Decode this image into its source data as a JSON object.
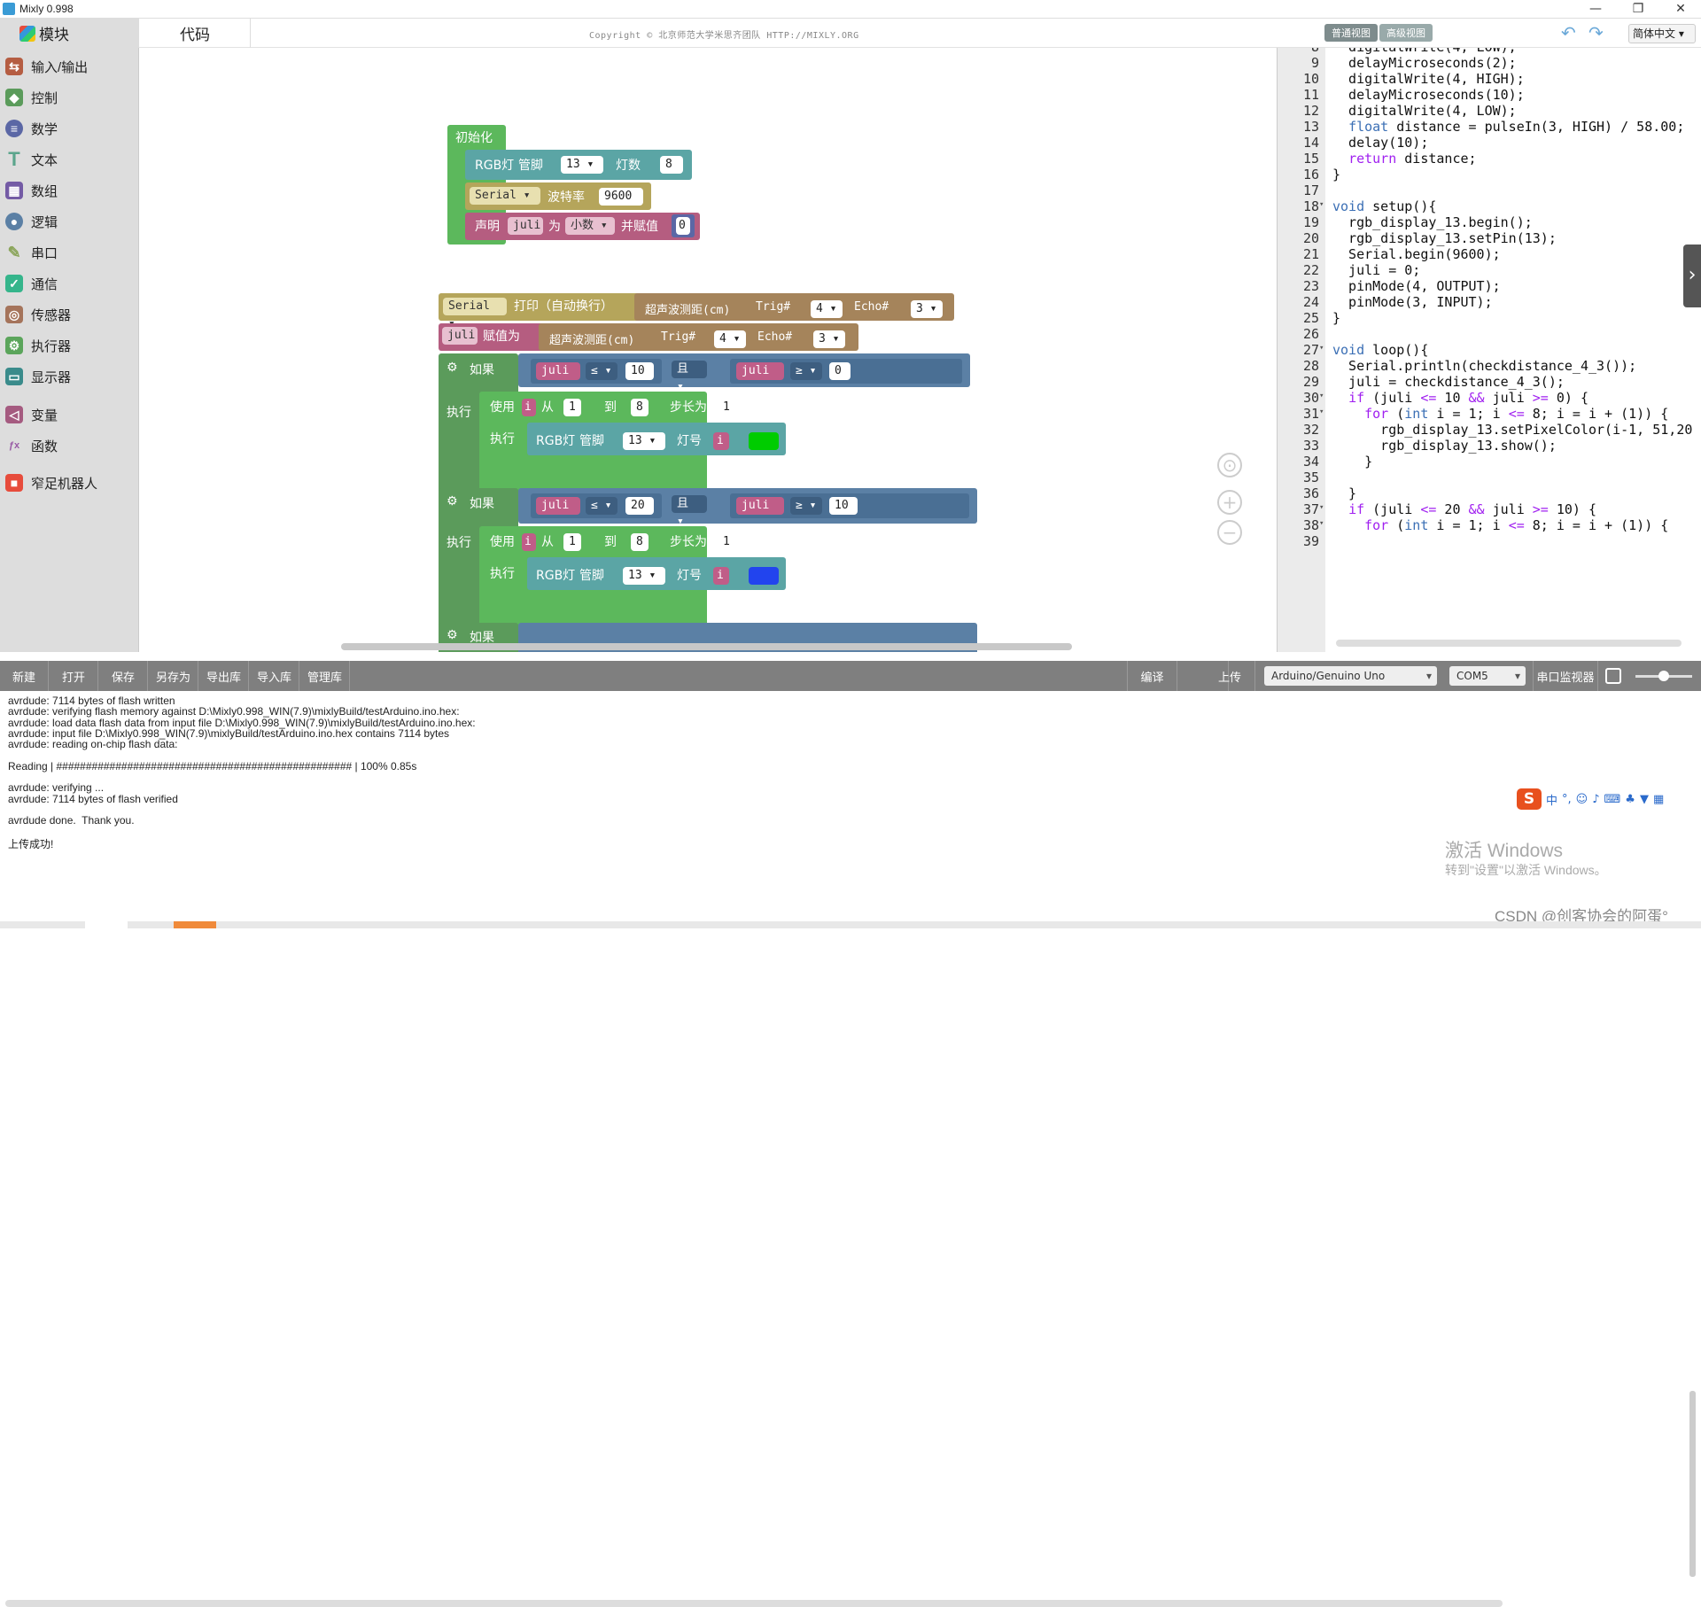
{
  "window": {
    "title": "Mixly 0.998",
    "min": "—",
    "max": "❐",
    "close": "✕"
  },
  "topbar": {
    "tab_blocks": "模块",
    "tab_code": "代码",
    "copyright": "Copyright © 北京师范大学米思齐团队 HTTP://MIXLY.ORG",
    "view_normal": "普通视图",
    "view_advanced": "高级视图",
    "language": "简体中文"
  },
  "sidebar": {
    "items": [
      {
        "label": "输入/输出",
        "icon": "io-icon",
        "color": "#b55d42"
      },
      {
        "label": "控制",
        "icon": "gamepad-icon",
        "color": "#5b9b5b"
      },
      {
        "label": "数学",
        "icon": "math-icon",
        "color": "#5b67a5"
      },
      {
        "label": "文本",
        "icon": "text-icon",
        "color": "#5ba58c"
      },
      {
        "label": "数组",
        "icon": "array-icon",
        "color": "#745ba5"
      },
      {
        "label": "逻辑",
        "icon": "bulb-icon",
        "color": "#5b80a5"
      },
      {
        "label": "串口",
        "icon": "pen-icon",
        "color": "#8ba55b"
      },
      {
        "label": "通信",
        "icon": "comm-icon",
        "color": "#35b58b"
      },
      {
        "label": "传感器",
        "icon": "sensor-icon",
        "color": "#a5745b"
      },
      {
        "label": "执行器",
        "icon": "actuator-icon",
        "color": "#5ba55b"
      },
      {
        "label": "显示器",
        "icon": "display-icon",
        "color": "#3a8b8b"
      },
      {
        "label": "变量",
        "icon": "variable-icon",
        "color": "#a55b80"
      },
      {
        "label": "函数",
        "icon": "function-icon",
        "color": "#995ba5"
      },
      {
        "label": "窄足机器人",
        "icon": "robot-icon",
        "color": "#e74c3c"
      }
    ]
  },
  "blocks": {
    "init": "初始化",
    "rgb": "RGB灯",
    "pin": "管脚",
    "pin13": "13",
    "count": "灯数",
    "count8": "8",
    "serial": "Serial",
    "baud": "波特率",
    "baud_val": "9600",
    "declare": "声明",
    "juli": "juli",
    "as": "为",
    "type": "小数",
    "assign": "并赋值",
    "zero": "0",
    "print": "打印（自动换行）",
    "ultra": "超声波测距(cm)",
    "trig": "Trig#",
    "trig_v": "4",
    "echo": "Echo#",
    "echo_v": "3",
    "assign_to": "赋值为",
    "if": "如果",
    "do": "执行",
    "and": "且",
    "le": "≤",
    "ge": "≥",
    "v10": "10",
    "v0": "0",
    "v20": "20",
    "for_use": "使用",
    "i": "i",
    "from": "从",
    "one": "1",
    "to": "到",
    "eight": "8",
    "step": "步长为",
    "step_v": "1",
    "lamp": "灯号",
    "color1": "#00cc00",
    "color2": "#2244ee"
  },
  "code": {
    "lines": [
      {
        "n": "8",
        "t": "  digitalWrite(4, LOW);"
      },
      {
        "n": "9",
        "t": "  delayMicroseconds(2);"
      },
      {
        "n": "10",
        "t": "  digitalWrite(4, HIGH);"
      },
      {
        "n": "11",
        "t": "  delayMicroseconds(10);"
      },
      {
        "n": "12",
        "t": "  digitalWrite(4, LOW);"
      },
      {
        "n": "13",
        "t": "  float distance = pulseIn(3, HIGH) / 58.00;"
      },
      {
        "n": "14",
        "t": "  delay(10);"
      },
      {
        "n": "15",
        "t": "  return distance;"
      },
      {
        "n": "16",
        "t": "}"
      },
      {
        "n": "17",
        "t": ""
      },
      {
        "n": "18",
        "t": "void setup(){"
      },
      {
        "n": "19",
        "t": "  rgb_display_13.begin();"
      },
      {
        "n": "20",
        "t": "  rgb_display_13.setPin(13);"
      },
      {
        "n": "21",
        "t": "  Serial.begin(9600);"
      },
      {
        "n": "22",
        "t": "  juli = 0;"
      },
      {
        "n": "23",
        "t": "  pinMode(4, OUTPUT);"
      },
      {
        "n": "24",
        "t": "  pinMode(3, INPUT);"
      },
      {
        "n": "25",
        "t": "}"
      },
      {
        "n": "26",
        "t": ""
      },
      {
        "n": "27",
        "t": "void loop(){"
      },
      {
        "n": "28",
        "t": "  Serial.println(checkdistance_4_3());"
      },
      {
        "n": "29",
        "t": "  juli = checkdistance_4_3();"
      },
      {
        "n": "30",
        "t": "  if (juli <= 10 && juli >= 0) {"
      },
      {
        "n": "31",
        "t": "    for (int i = 1; i <= 8; i = i + (1)) {"
      },
      {
        "n": "32",
        "t": "      rgb_display_13.setPixelColor(i-1, 51,20"
      },
      {
        "n": "33",
        "t": "      rgb_display_13.show();"
      },
      {
        "n": "34",
        "t": "    }"
      },
      {
        "n": "35",
        "t": ""
      },
      {
        "n": "36",
        "t": "  }"
      },
      {
        "n": "37",
        "t": "  if (juli <= 20 && juli >= 10) {"
      },
      {
        "n": "38",
        "t": "    for (int i = 1; i <= 8; i = i + (1)) {"
      },
      {
        "n": "39",
        "t": ""
      }
    ]
  },
  "toolbar": {
    "new": "新建",
    "open": "打开",
    "save": "保存",
    "saveas": "另存为",
    "export": "导出库",
    "import": "导入库",
    "manage": "管理库",
    "compile": "编译",
    "upload": "上传",
    "board": "Arduino/Genuino Uno",
    "port": "COM5",
    "monitor": "串口监视器"
  },
  "console": {
    "lines": [
      "avrdude: 7114 bytes of flash written",
      "avrdude: verifying flash memory against D:\\Mixly0.998_WIN(7.9)\\mixlyBuild/testArduino.ino.hex:",
      "avrdude: load data flash data from input file D:\\Mixly0.998_WIN(7.9)\\mixlyBuild/testArduino.ino.hex:",
      "avrdude: input file D:\\Mixly0.998_WIN(7.9)\\mixlyBuild/testArduino.ino.hex contains 7114 bytes",
      "avrdude: reading on-chip flash data:",
      "",
      "Reading | ################################################## | 100% 0.85s",
      "",
      "avrdude: verifying ...",
      "avrdude: 7114 bytes of flash verified",
      "",
      "avrdude done.  Thank you.",
      "",
      "上传成功!"
    ]
  },
  "overlay": {
    "ime": "中",
    "activate": "激活 Windows",
    "activate_sub": "转到\"设置\"以激活 Windows。",
    "csdn": "CSDN @创客协会的阿蛋°"
  }
}
